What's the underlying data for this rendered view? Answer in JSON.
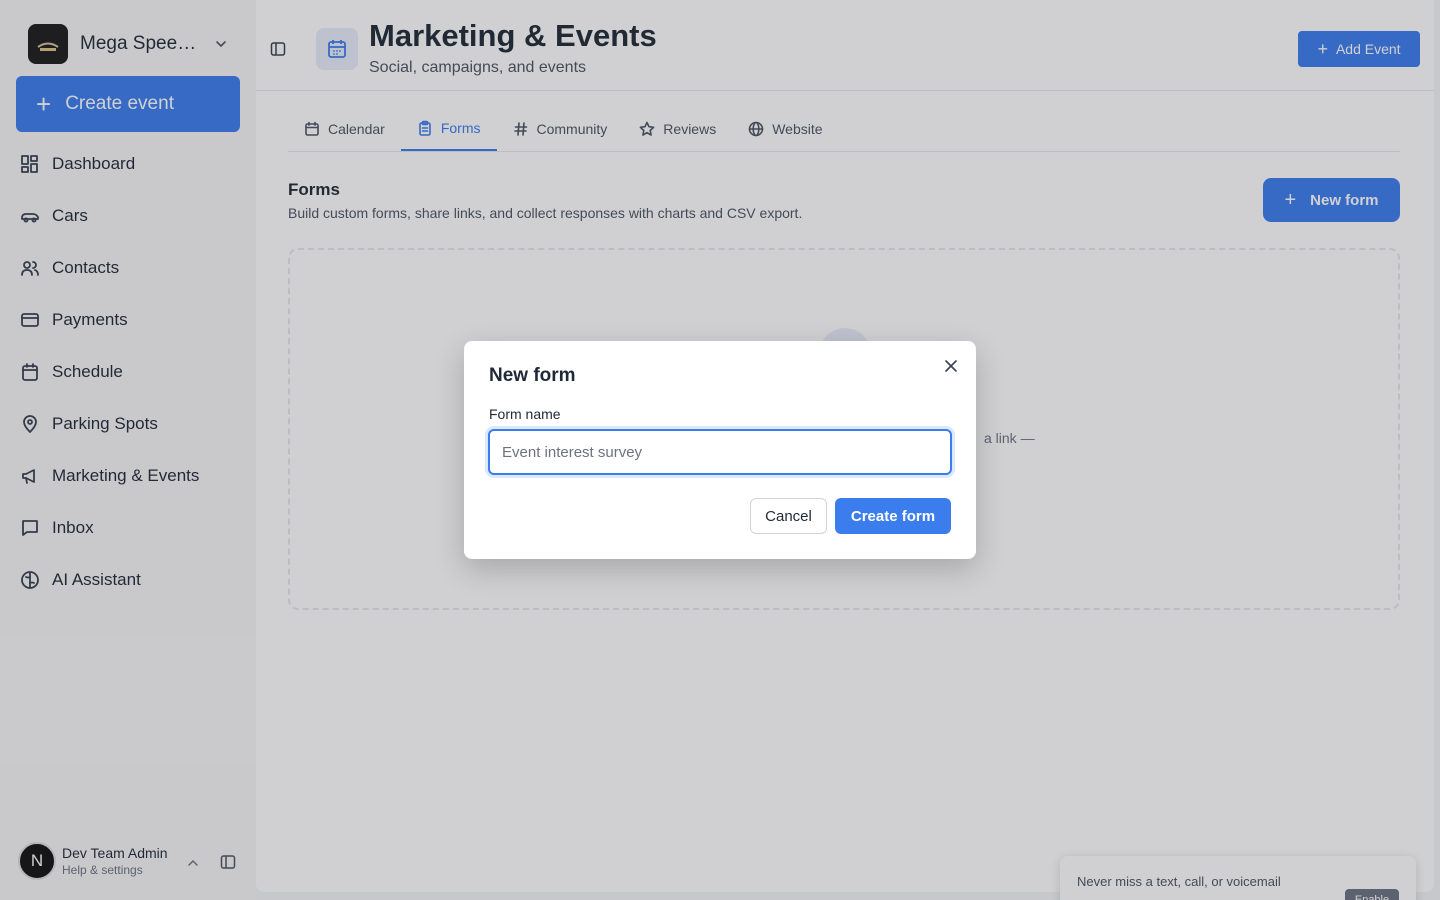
{
  "sidebar": {
    "brand_name": "Mega Speed Storage",
    "create_label": "Create event",
    "items": [
      {
        "label": "Dashboard",
        "icon": "dashboard-icon"
      },
      {
        "label": "Cars",
        "icon": "car-icon"
      },
      {
        "label": "Contacts",
        "icon": "contacts-icon"
      },
      {
        "label": "Payments",
        "icon": "credit-card-icon"
      },
      {
        "label": "Schedule",
        "icon": "calendar-icon"
      },
      {
        "label": "Parking Spots",
        "icon": "map-pin-icon"
      },
      {
        "label": "Marketing & Events",
        "icon": "megaphone-icon"
      },
      {
        "label": "Inbox",
        "icon": "message-icon"
      },
      {
        "label": "AI Assistant",
        "icon": "brain-icon"
      }
    ],
    "user": {
      "initial": "N",
      "name": "Dev Team Admin",
      "sub": "Help & settings"
    }
  },
  "header": {
    "title": "Marketing & Events",
    "subtitle": "Social, campaigns, and events",
    "add_event_label": "Add Event"
  },
  "tabs": [
    {
      "label": "Calendar",
      "icon": "calendar-icon",
      "active": false
    },
    {
      "label": "Forms",
      "icon": "clipboard-icon",
      "active": true
    },
    {
      "label": "Community",
      "icon": "hash-icon",
      "active": false
    },
    {
      "label": "Reviews",
      "icon": "star-icon",
      "active": false
    },
    {
      "label": "Website",
      "icon": "globe-icon",
      "active": false
    }
  ],
  "forms": {
    "title": "Forms",
    "description": "Build custom forms, share links, and collect responses with charts and CSV export.",
    "new_form_label": "New form",
    "empty_text_fragment": "a link —"
  },
  "modal": {
    "title": "New form",
    "field_label": "Form name",
    "field_value": "",
    "field_placeholder": "Event interest survey",
    "cancel_label": "Cancel",
    "submit_label": "Create form"
  },
  "toast": {
    "text": "Never miss a text, call, or voicemail",
    "button_label": "Enable"
  },
  "colors": {
    "accent": "#3b7ded",
    "sidebar_bg": "#f7f7f8",
    "text_primary": "#1f2937"
  }
}
